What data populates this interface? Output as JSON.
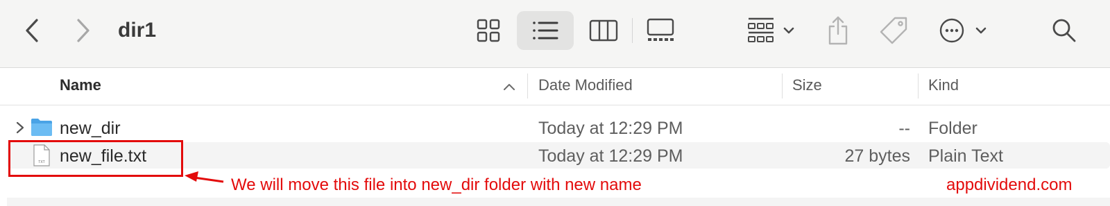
{
  "toolbar": {
    "title": "dir1",
    "icons": [
      "back-icon",
      "forward-icon",
      "icon-view-icon",
      "list-view-icon",
      "column-view-icon",
      "gallery-view-icon",
      "group-icon",
      "share-icon",
      "tag-icon",
      "more-icon",
      "search-icon"
    ],
    "active_view": "list"
  },
  "columns": {
    "name": "Name",
    "date_modified": "Date Modified",
    "size": "Size",
    "kind": "Kind"
  },
  "files": [
    {
      "name": "new_dir",
      "date_modified": "Today at 12:29 PM",
      "size": "--",
      "kind": "Folder",
      "icon": "folder-icon"
    },
    {
      "name": "new_file.txt",
      "date_modified": "Today at 12:29 PM",
      "size": "27 bytes",
      "kind": "Plain Text",
      "icon": "txt-file-icon",
      "file_badge": "TXT"
    }
  ],
  "annotation": {
    "text": "We will move this file into new_dir folder with new name",
    "watermark": "appdividend.com"
  },
  "colors": {
    "annotation": "#e30b0b",
    "folder": "#5fb3ec",
    "toolbar_bg": "#f5f5f4"
  }
}
